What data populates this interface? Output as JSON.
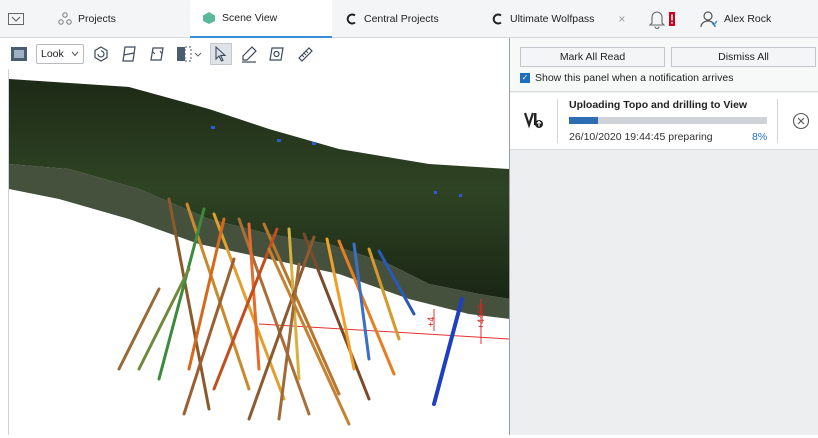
{
  "tabs": {
    "projects": "Projects",
    "scene_view": "Scene View",
    "central_projects": "Central Projects",
    "ultimate_wolfpass": "Ultimate Wolfpass",
    "close": "×"
  },
  "header": {
    "user": "Alex Rock"
  },
  "toolbar": {
    "look": "Look"
  },
  "notifications": {
    "mark_all_read": "Mark All Read",
    "dismiss_all": "Dismiss All",
    "show_panel_label": "Show this panel when a notification arrives",
    "show_panel_checked": true,
    "item": {
      "title": "Uploading Topo and drilling to View",
      "timestamp": "26/10/2020 19:44:45 preparing",
      "progress_label": "8%",
      "progress": 0.08
    }
  },
  "scene": {
    "label_a": "+4466",
    "label_b": "+4"
  },
  "colors": {
    "accent": "#3a8fd6",
    "progress": "#2e6db3",
    "alert": "#d0021b"
  }
}
